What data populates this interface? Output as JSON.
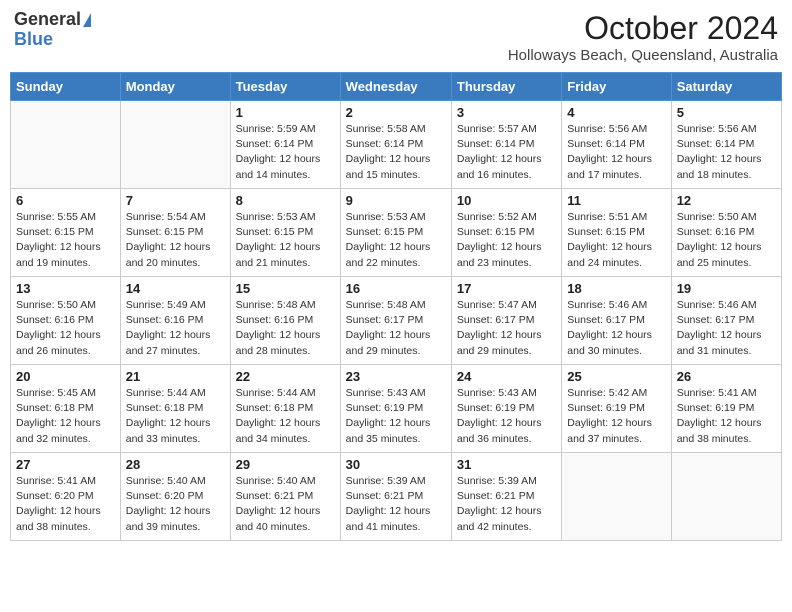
{
  "header": {
    "logo_general": "General",
    "logo_blue": "Blue",
    "month_title": "October 2024",
    "location": "Holloways Beach, Queensland, Australia"
  },
  "days_of_week": [
    "Sunday",
    "Monday",
    "Tuesday",
    "Wednesday",
    "Thursday",
    "Friday",
    "Saturday"
  ],
  "weeks": [
    [
      {
        "day": "",
        "info": ""
      },
      {
        "day": "",
        "info": ""
      },
      {
        "day": "1",
        "info": "Sunrise: 5:59 AM\nSunset: 6:14 PM\nDaylight: 12 hours and 14 minutes."
      },
      {
        "day": "2",
        "info": "Sunrise: 5:58 AM\nSunset: 6:14 PM\nDaylight: 12 hours and 15 minutes."
      },
      {
        "day": "3",
        "info": "Sunrise: 5:57 AM\nSunset: 6:14 PM\nDaylight: 12 hours and 16 minutes."
      },
      {
        "day": "4",
        "info": "Sunrise: 5:56 AM\nSunset: 6:14 PM\nDaylight: 12 hours and 17 minutes."
      },
      {
        "day": "5",
        "info": "Sunrise: 5:56 AM\nSunset: 6:14 PM\nDaylight: 12 hours and 18 minutes."
      }
    ],
    [
      {
        "day": "6",
        "info": "Sunrise: 5:55 AM\nSunset: 6:15 PM\nDaylight: 12 hours and 19 minutes."
      },
      {
        "day": "7",
        "info": "Sunrise: 5:54 AM\nSunset: 6:15 PM\nDaylight: 12 hours and 20 minutes."
      },
      {
        "day": "8",
        "info": "Sunrise: 5:53 AM\nSunset: 6:15 PM\nDaylight: 12 hours and 21 minutes."
      },
      {
        "day": "9",
        "info": "Sunrise: 5:53 AM\nSunset: 6:15 PM\nDaylight: 12 hours and 22 minutes."
      },
      {
        "day": "10",
        "info": "Sunrise: 5:52 AM\nSunset: 6:15 PM\nDaylight: 12 hours and 23 minutes."
      },
      {
        "day": "11",
        "info": "Sunrise: 5:51 AM\nSunset: 6:15 PM\nDaylight: 12 hours and 24 minutes."
      },
      {
        "day": "12",
        "info": "Sunrise: 5:50 AM\nSunset: 6:16 PM\nDaylight: 12 hours and 25 minutes."
      }
    ],
    [
      {
        "day": "13",
        "info": "Sunrise: 5:50 AM\nSunset: 6:16 PM\nDaylight: 12 hours and 26 minutes."
      },
      {
        "day": "14",
        "info": "Sunrise: 5:49 AM\nSunset: 6:16 PM\nDaylight: 12 hours and 27 minutes."
      },
      {
        "day": "15",
        "info": "Sunrise: 5:48 AM\nSunset: 6:16 PM\nDaylight: 12 hours and 28 minutes."
      },
      {
        "day": "16",
        "info": "Sunrise: 5:48 AM\nSunset: 6:17 PM\nDaylight: 12 hours and 29 minutes."
      },
      {
        "day": "17",
        "info": "Sunrise: 5:47 AM\nSunset: 6:17 PM\nDaylight: 12 hours and 29 minutes."
      },
      {
        "day": "18",
        "info": "Sunrise: 5:46 AM\nSunset: 6:17 PM\nDaylight: 12 hours and 30 minutes."
      },
      {
        "day": "19",
        "info": "Sunrise: 5:46 AM\nSunset: 6:17 PM\nDaylight: 12 hours and 31 minutes."
      }
    ],
    [
      {
        "day": "20",
        "info": "Sunrise: 5:45 AM\nSunset: 6:18 PM\nDaylight: 12 hours and 32 minutes."
      },
      {
        "day": "21",
        "info": "Sunrise: 5:44 AM\nSunset: 6:18 PM\nDaylight: 12 hours and 33 minutes."
      },
      {
        "day": "22",
        "info": "Sunrise: 5:44 AM\nSunset: 6:18 PM\nDaylight: 12 hours and 34 minutes."
      },
      {
        "day": "23",
        "info": "Sunrise: 5:43 AM\nSunset: 6:19 PM\nDaylight: 12 hours and 35 minutes."
      },
      {
        "day": "24",
        "info": "Sunrise: 5:43 AM\nSunset: 6:19 PM\nDaylight: 12 hours and 36 minutes."
      },
      {
        "day": "25",
        "info": "Sunrise: 5:42 AM\nSunset: 6:19 PM\nDaylight: 12 hours and 37 minutes."
      },
      {
        "day": "26",
        "info": "Sunrise: 5:41 AM\nSunset: 6:19 PM\nDaylight: 12 hours and 38 minutes."
      }
    ],
    [
      {
        "day": "27",
        "info": "Sunrise: 5:41 AM\nSunset: 6:20 PM\nDaylight: 12 hours and 38 minutes."
      },
      {
        "day": "28",
        "info": "Sunrise: 5:40 AM\nSunset: 6:20 PM\nDaylight: 12 hours and 39 minutes."
      },
      {
        "day": "29",
        "info": "Sunrise: 5:40 AM\nSunset: 6:21 PM\nDaylight: 12 hours and 40 minutes."
      },
      {
        "day": "30",
        "info": "Sunrise: 5:39 AM\nSunset: 6:21 PM\nDaylight: 12 hours and 41 minutes."
      },
      {
        "day": "31",
        "info": "Sunrise: 5:39 AM\nSunset: 6:21 PM\nDaylight: 12 hours and 42 minutes."
      },
      {
        "day": "",
        "info": ""
      },
      {
        "day": "",
        "info": ""
      }
    ]
  ]
}
